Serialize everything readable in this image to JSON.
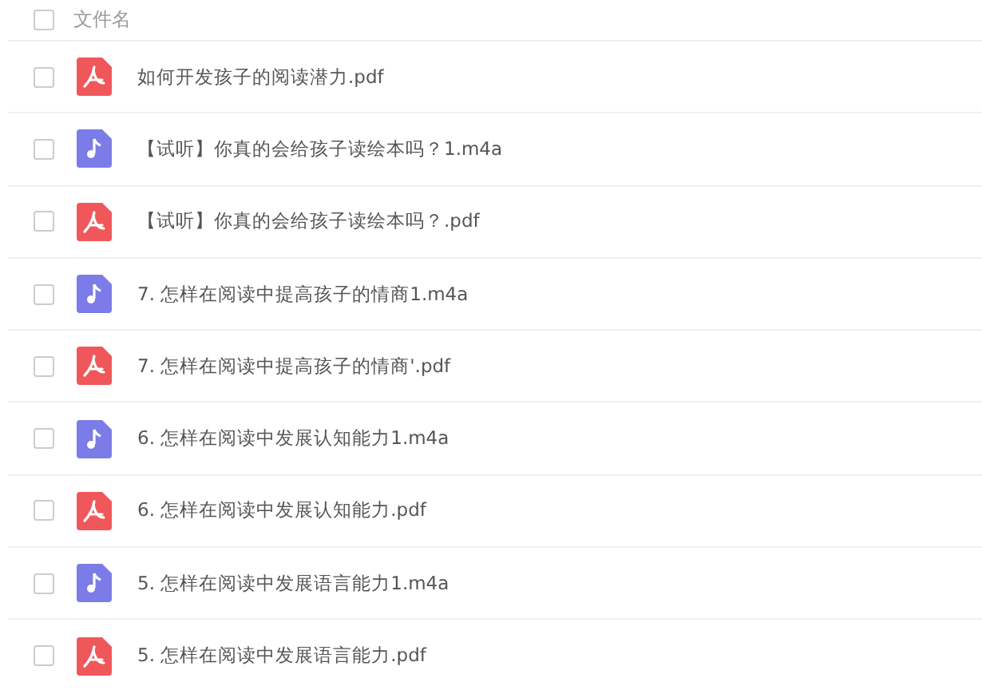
{
  "header": {
    "checked": false,
    "label": "文件名"
  },
  "files": [
    {
      "kind": "pdf",
      "name": "如何开发孩子的阅读潜力.pdf",
      "checked": false
    },
    {
      "kind": "audio",
      "name": "【试听】你真的会给孩子读绘本吗？1.m4a",
      "checked": false
    },
    {
      "kind": "pdf",
      "name": "【试听】你真的会给孩子读绘本吗？.pdf",
      "checked": false
    },
    {
      "kind": "audio",
      "name": "7. 怎样在阅读中提高孩子的情商1.m4a",
      "checked": false
    },
    {
      "kind": "pdf",
      "name": "7. 怎样在阅读中提高孩子的情商'.pdf",
      "checked": false
    },
    {
      "kind": "audio",
      "name": "6. 怎样在阅读中发展认知能力1.m4a",
      "checked": false
    },
    {
      "kind": "pdf",
      "name": "6. 怎样在阅读中发展认知能力.pdf",
      "checked": false
    },
    {
      "kind": "audio",
      "name": "5. 怎样在阅读中发展语言能力1.m4a",
      "checked": false
    },
    {
      "kind": "pdf",
      "name": "5. 怎样在阅读中发展语言能力.pdf",
      "checked": false
    }
  ]
}
